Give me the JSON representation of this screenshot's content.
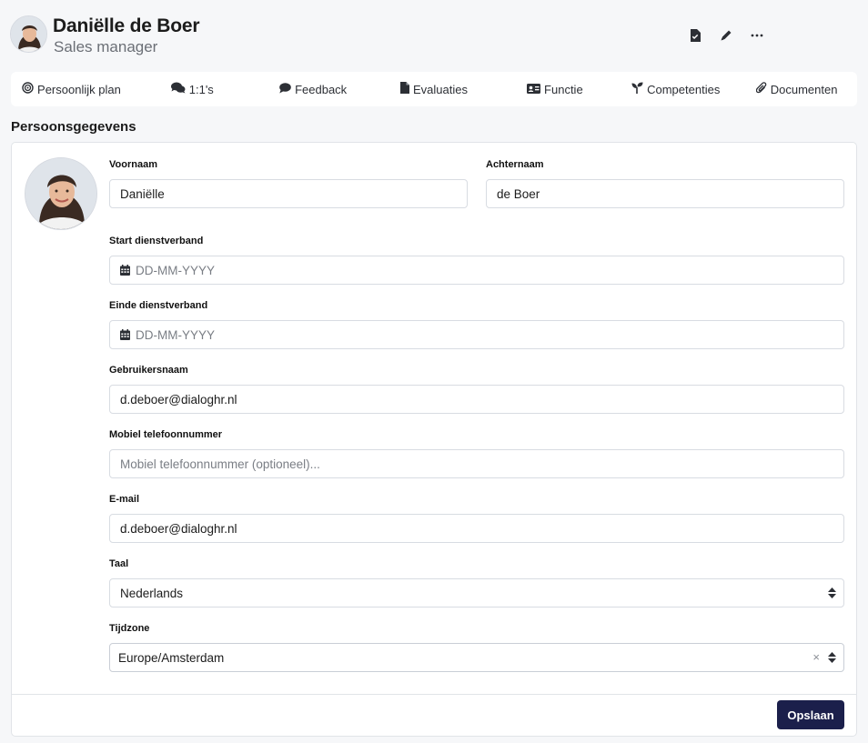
{
  "header": {
    "name": "Daniëlle de Boer",
    "role": "Sales manager",
    "icons": [
      "document-check-icon",
      "pencil-icon",
      "more-icon"
    ]
  },
  "tabs": [
    {
      "label": "Persoonlijk plan",
      "icon": "target-icon"
    },
    {
      "label": "1:1's",
      "icon": "comments-icon"
    },
    {
      "label": "Feedback",
      "icon": "comment-icon"
    },
    {
      "label": "Evaluaties",
      "icon": "file-icon"
    },
    {
      "label": "Functie",
      "icon": "id-card-icon"
    },
    {
      "label": "Competenties",
      "icon": "seedling-icon"
    },
    {
      "label": "Documenten",
      "icon": "paperclip-icon"
    }
  ],
  "section": {
    "title": "Persoonsgegevens"
  },
  "form": {
    "first_name": {
      "label": "Voornaam",
      "value": "Daniëlle"
    },
    "last_name": {
      "label": "Achternaam",
      "value": "de Boer"
    },
    "start_date": {
      "label": "Start dienstverband",
      "placeholder": "DD-MM-YYYY"
    },
    "end_date": {
      "label": "Einde dienstverband",
      "placeholder": "DD-MM-YYYY"
    },
    "username": {
      "label": "Gebruikersnaam",
      "value": "d.deboer@dialoghr.nl"
    },
    "mobile": {
      "label": "Mobiel telefoonnummer",
      "placeholder": "Mobiel telefoonnummer (optioneel)..."
    },
    "email": {
      "label": "E-mail",
      "value": "d.deboer@dialoghr.nl"
    },
    "language": {
      "label": "Taal",
      "value": "Nederlands"
    },
    "timezone": {
      "label": "Tijdzone",
      "value": "Europe/Amsterdam",
      "clear": "×"
    }
  },
  "save_label": "Opslaan",
  "colors": {
    "primary": "#1b1f4b",
    "background": "#f6f7f9",
    "border": "#d8dce2"
  }
}
